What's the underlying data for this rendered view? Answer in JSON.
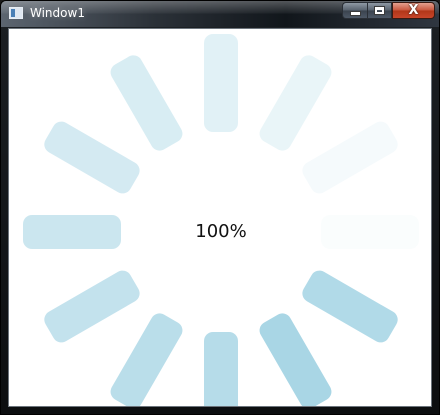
{
  "window": {
    "title": "Window1",
    "icon": "app-window-icon"
  },
  "caption_buttons": {
    "minimize_icon": "minimize-icon",
    "maximize_icon": "maximize-icon",
    "close_icon": "close-icon",
    "close_glyph": "X"
  },
  "progress": {
    "label": "100%",
    "value": 1.0,
    "segment_count": 12,
    "segment_color": "#a9d6e5",
    "segment_opacities": [
      0.35,
      0.25,
      0.12,
      0.06,
      0.9,
      1.0,
      0.85,
      0.8,
      0.7,
      0.6,
      0.5,
      0.45
    ]
  }
}
